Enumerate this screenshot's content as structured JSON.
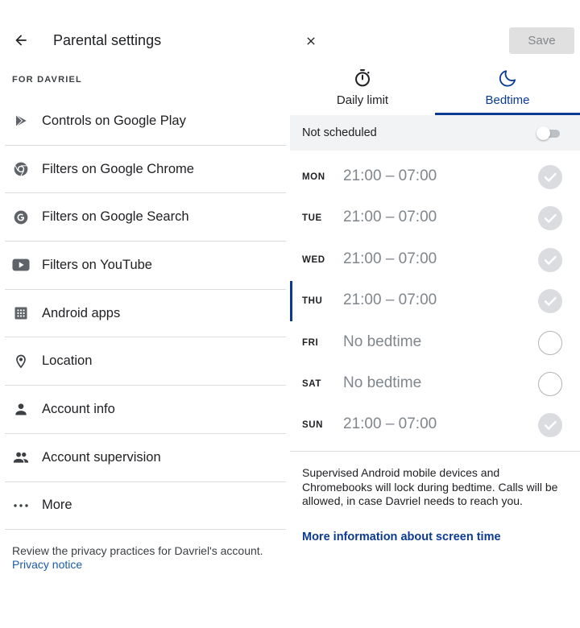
{
  "left": {
    "title": "Parental settings",
    "section_label": "FOR DAVRIEL",
    "menu": [
      {
        "label": "Controls on Google Play",
        "icon": "play-icon"
      },
      {
        "label": "Filters on Google Chrome",
        "icon": "chrome-icon"
      },
      {
        "label": "Filters on Google Search",
        "icon": "google-icon"
      },
      {
        "label": "Filters on YouTube",
        "icon": "youtube-icon"
      },
      {
        "label": "Android apps",
        "icon": "apps-grid-icon"
      },
      {
        "label": "Location",
        "icon": "location-pin-icon"
      },
      {
        "label": "Account info",
        "icon": "person-icon"
      },
      {
        "label": "Account supervision",
        "icon": "people-icon"
      },
      {
        "label": "More",
        "icon": "more-horizontal-icon"
      }
    ],
    "privacy_text": "Review the privacy practices for Davriel's account.",
    "privacy_link": "Privacy notice"
  },
  "right": {
    "save_label": "Save",
    "tabs": [
      {
        "label": "Daily limit",
        "icon": "timer-icon"
      },
      {
        "label": "Bedtime",
        "icon": "moon-icon",
        "selected": true
      }
    ],
    "not_scheduled_label": "Not scheduled",
    "days": [
      {
        "name": "MON",
        "time": "21:00 – 07:00",
        "checked": true
      },
      {
        "name": "TUE",
        "time": "21:00 – 07:00",
        "checked": true
      },
      {
        "name": "WED",
        "time": "21:00 – 07:00",
        "checked": true
      },
      {
        "name": "THU",
        "time": "21:00 – 07:00",
        "checked": true,
        "current": true
      },
      {
        "name": "FRI",
        "time": "No bedtime",
        "checked": false
      },
      {
        "name": "SAT",
        "time": "No bedtime",
        "checked": false
      },
      {
        "name": "SUN",
        "time": "21:00 – 07:00",
        "checked": true
      }
    ],
    "info_text": "Supervised Android mobile devices and Chromebooks will lock during bedtime. Calls will be allowed, in case Davriel needs to reach you.",
    "more_info_link": "More information about screen time"
  },
  "colors": {
    "accent": "#0b3b91",
    "link": "#1a5ba8",
    "muted_text": "#80868b",
    "divider": "#dadce0"
  }
}
